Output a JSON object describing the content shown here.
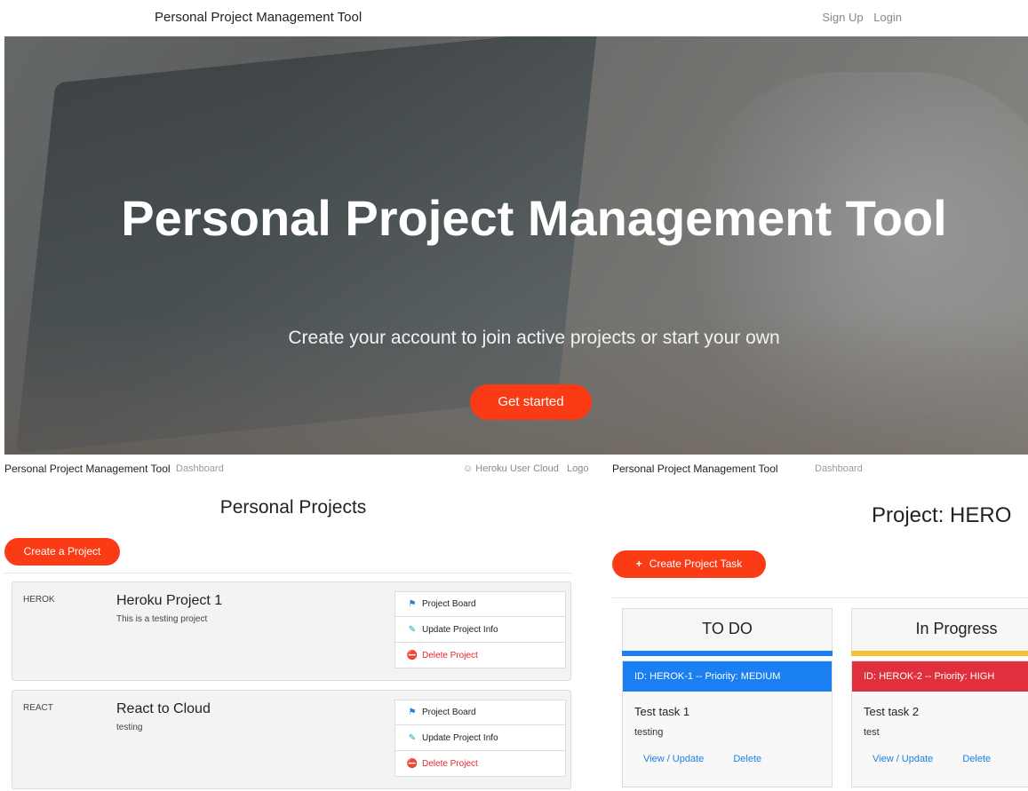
{
  "topnav": {
    "brand": "Personal Project Management Tool",
    "signup": "Sign Up",
    "login": "Login"
  },
  "hero": {
    "title": "Personal Project Management Tool",
    "subtitle": "Create your account to join active projects or start your own",
    "cta": "Get started"
  },
  "dashboard": {
    "brand": "Personal Project Management Tool",
    "nav_dashboard": "Dashboard",
    "user": "Heroku User Cloud",
    "logout": "Logo",
    "title": "Personal Projects",
    "create_button": "Create a Project",
    "projects": [
      {
        "key": "HEROK",
        "name": "Heroku Project 1",
        "description": "This is a testing project",
        "board": "Project Board",
        "update": "Update Project Info",
        "delete": "Delete Project"
      },
      {
        "key": "REACT",
        "name": "React to Cloud",
        "description": "testing",
        "board": "Project Board",
        "update": "Update Project Info",
        "delete": "Delete Project"
      }
    ]
  },
  "board": {
    "brand": "Personal Project Management Tool",
    "nav_dashboard": "Dashboard",
    "title": "Project: HERO",
    "create_button": "Create Project Task",
    "columns": [
      {
        "name": "TO DO",
        "color": "#1a7ff0",
        "task": {
          "caption": "ID: HEROK-1 -- Priority: MEDIUM",
          "caption_color": "#1a7ff0",
          "title": "Test task 1",
          "body": "testing",
          "view": "View / Update",
          "delete": "Delete"
        }
      },
      {
        "name": "In Progress",
        "color": "#f5c132",
        "task": {
          "caption": "ID: HEROK-2 -- Priority: HIGH",
          "caption_color": "#e0303e",
          "title": "Test task 2",
          "body": "test",
          "view": "View / Update",
          "delete": "Delete"
        }
      }
    ]
  },
  "colors": {
    "accent": "#fa3b16",
    "link": "#1e7fe0",
    "danger": "#e6252e"
  }
}
